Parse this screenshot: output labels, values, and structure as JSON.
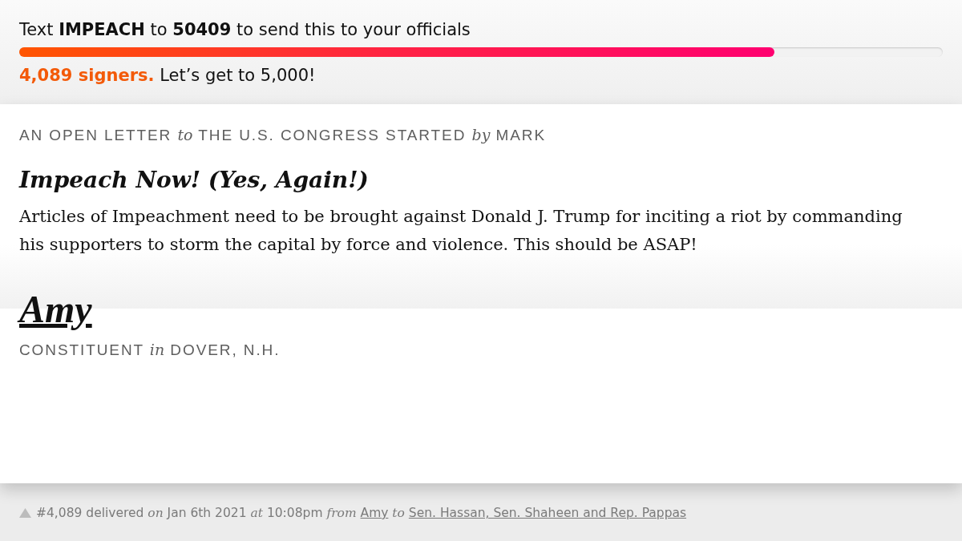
{
  "sms_prompt": "Text **IMPEACH** to **50409** to send this to your officials",
  "progress": {
    "level": 0.818
  },
  "signers": "**4,089 signers.** Let’s get to 5,000!",
  "letter": {
    "meta": "AN OPEN LETTER *to* THE U.S. CONGRESS STARTED *by* MARK",
    "title": "Impeach Now! (Yes, Again!)",
    "body": "Articles of Impeachment need to be brought against Donald J. Trump for inciting a riot by commanding his supporters to storm the capital by force and violence. This should be ASAP!",
    "signature": "Amy",
    "signer_info": "CONSTITUENT *in* DOVER, N.H."
  },
  "delivery": {
    "summary": "#4,089 delivered *on* Jan 6th 2021 *at* 10:08pm *from*",
    "sender": "Amy",
    "connector": "to",
    "recipients": "Sen. Hassan, Sen. Shaheen and Rep. Pappas"
  }
}
